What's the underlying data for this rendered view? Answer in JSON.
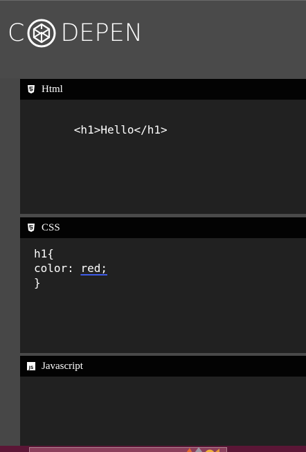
{
  "logo": {
    "left_letter": "C",
    "right_letters": "DEPEN",
    "mark_icon": "codepen-cube-icon"
  },
  "panels": [
    {
      "icon": "html5-icon",
      "title": "Html",
      "code": "<h1>Hello</h1>"
    },
    {
      "icon": "css3-icon",
      "title": "CSS",
      "code_lines": [
        "h1{",
        "color: ",
        "red;",
        "}"
      ]
    },
    {
      "icon": "javascript-icon",
      "title": "Javascript",
      "icon_label": "JS",
      "code": ""
    }
  ],
  "colors": {
    "background": "#4a4a4a",
    "panel_header": "#030303",
    "panel_body": "#212121",
    "text": "#ffffff",
    "spellcheck_underline": "#3f5ce8",
    "taskbar": "#5b1636"
  }
}
